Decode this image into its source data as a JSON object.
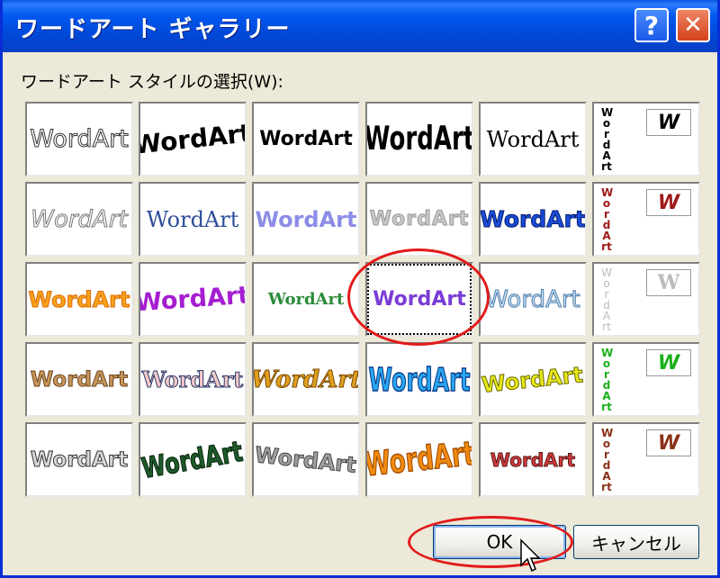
{
  "window": {
    "title": "ワードアート ギャラリー",
    "help_label": "?",
    "close_label": "✕"
  },
  "prompt": "ワードアート スタイルの選択(W):",
  "gallery": {
    "sample_text": "WordArt",
    "vertical_text": "WordArt",
    "mini_text": "W",
    "selected": {
      "row": 3,
      "column": 4
    }
  },
  "buttons": {
    "ok": "OK",
    "cancel": "キャンセル"
  },
  "colors": {
    "highlight": "#e21b1b",
    "titlebar": "#0058ee"
  }
}
